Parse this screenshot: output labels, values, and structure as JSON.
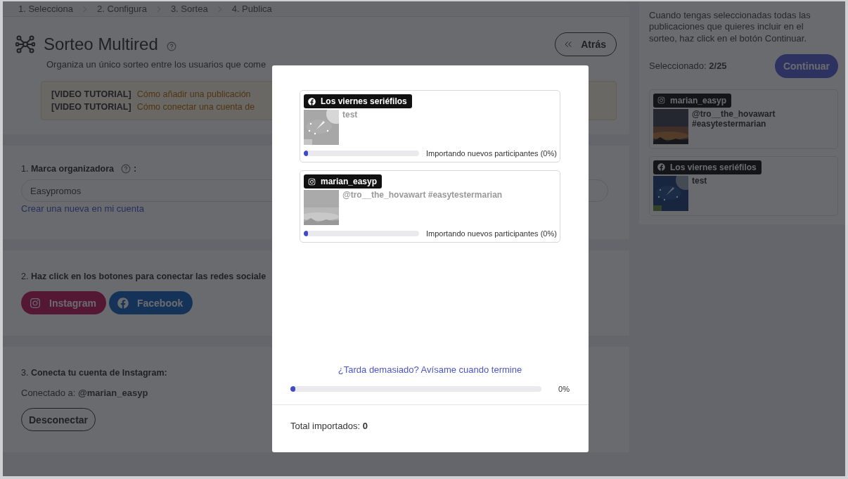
{
  "steps": [
    "1. Selecciona",
    "2. Configura",
    "3. Sortea",
    "4. Publica"
  ],
  "header": {
    "title": "Sorteo Multired",
    "description": "Organiza un único sorteo entre los usuarios que come",
    "back_button": "Atrás",
    "tutorials": [
      {
        "tag": "[VIDEO TUTORIAL]",
        "link": "Cómo añadir una publicación"
      },
      {
        "tag": "[VIDEO TUTORIAL]",
        "link": "Cómo conectar una cuenta de"
      }
    ]
  },
  "sections": [
    {
      "kind": "brand",
      "number": "1.",
      "label": "Marca organizadora",
      "suffix": ":",
      "value": "Easypromos",
      "link": "Crear una nueva en mi cuenta"
    },
    {
      "kind": "networks",
      "number": "2.",
      "label": "Haz click en los botones para conectar las redes sociale",
      "buttons": [
        {
          "kind": "instagram",
          "label": "Instagram"
        },
        {
          "kind": "facebook",
          "label": "Facebook"
        }
      ]
    },
    {
      "kind": "connect",
      "number": "3.",
      "label": "Conecta tu cuenta de Instagram:",
      "connected_label": "Conectado a:",
      "account": "@marian_easyp",
      "button": "Desconectar"
    }
  ],
  "sidebar": {
    "instructions": "Cuando tengas seleccionadas todas las publicaciones que quieres incluir en el sorteo, haz click en el botón Continuar.",
    "selected_label": "Seleccionado:",
    "selected_count": "2/25",
    "continue_button": "Continuar",
    "posts": [
      {
        "kind": "instagram",
        "account": "marian_easyp",
        "text": "@tro__the_hovawart #easytestermarian"
      },
      {
        "kind": "facebook",
        "account": "Los viernes seriéfilos",
        "text": "test"
      }
    ]
  },
  "modal": {
    "posts": [
      {
        "kind": "facebook",
        "account": "Los viernes seriéfilos",
        "text": "test",
        "status": "Importando nuevos participantes (0%)",
        "level": 0.02
      },
      {
        "kind": "instagram",
        "account": "marian_easyp",
        "text": "@tro__the_hovawart #easytestermarian",
        "status": "Importando nuevos participantes (0%)",
        "level": 0.02
      }
    ],
    "notify_link": "¿Tarda demasiado? Avísame cuando termine",
    "overall": {
      "level": 0.02,
      "reading": "0%"
    },
    "total_label": "Total importados:",
    "total": "0"
  }
}
